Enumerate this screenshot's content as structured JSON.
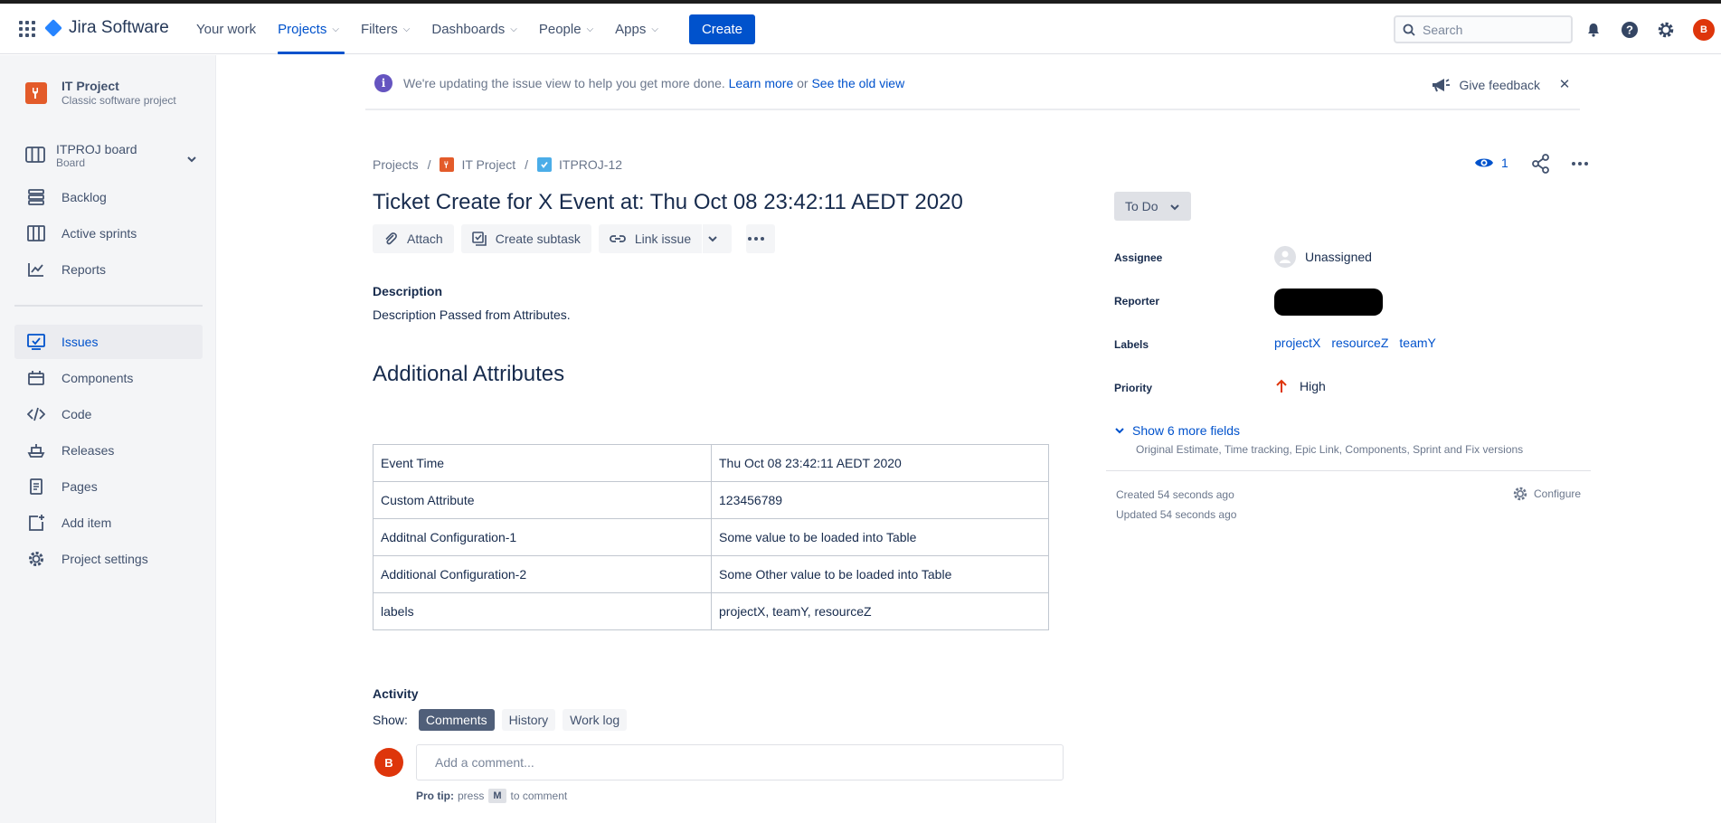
{
  "header": {
    "product": "Jira Software",
    "nav": [
      {
        "label": "Your work",
        "dropdown": false,
        "active": false
      },
      {
        "label": "Projects",
        "dropdown": true,
        "active": true
      },
      {
        "label": "Filters",
        "dropdown": true,
        "active": false
      },
      {
        "label": "Dashboards",
        "dropdown": true,
        "active": false
      },
      {
        "label": "People",
        "dropdown": true,
        "active": false
      },
      {
        "label": "Apps",
        "dropdown": true,
        "active": false
      }
    ],
    "create_label": "Create",
    "search_placeholder": "Search",
    "avatar_initial": "B"
  },
  "sidebar": {
    "project_name": "IT Project",
    "project_type": "Classic software project",
    "board_name": "ITPROJ board",
    "board_type": "Board",
    "items": [
      {
        "label": "Backlog",
        "icon": "backlog-icon"
      },
      {
        "label": "Active sprints",
        "icon": "active-sprints-icon"
      },
      {
        "label": "Reports",
        "icon": "reports-icon"
      }
    ],
    "items2": [
      {
        "label": "Issues",
        "icon": "issues-icon",
        "active": true
      },
      {
        "label": "Components",
        "icon": "components-icon"
      },
      {
        "label": "Code",
        "icon": "code-icon"
      },
      {
        "label": "Releases",
        "icon": "releases-icon"
      },
      {
        "label": "Pages",
        "icon": "pages-icon"
      },
      {
        "label": "Add item",
        "icon": "add-item-icon"
      },
      {
        "label": "Project settings",
        "icon": "settings-icon"
      }
    ]
  },
  "banner": {
    "text": "We're updating the issue view to help you get more done.",
    "learn_more": "Learn more",
    "or": "or",
    "old_view": "See the old view",
    "feedback": "Give feedback"
  },
  "issue": {
    "breadcrumb": [
      "Projects",
      "IT Project",
      "ITPROJ-12"
    ],
    "title": "Ticket Create for X Event at: Thu Oct 08 23:42:11 AEDT 2020",
    "toolbar": {
      "attach": "Attach",
      "subtask": "Create subtask",
      "link": "Link issue"
    },
    "description_heading": "Description",
    "description": "Description Passed from Attributes.",
    "additional_heading": "Additional Attributes",
    "attributes": [
      [
        "Event Time",
        "Thu Oct 08 23:42:11 AEDT 2020"
      ],
      [
        "Custom Attribute",
        "123456789"
      ],
      [
        "Additnal Configuration-1",
        "Some value to be loaded into Table"
      ],
      [
        "Additional Configuration-2",
        "Some Other value to be loaded into Table"
      ],
      [
        "labels",
        "projectX, teamY, resourceZ"
      ]
    ],
    "activity": {
      "heading": "Activity",
      "show_label": "Show:",
      "tabs": [
        "Comments",
        "History",
        "Work log"
      ],
      "comment_placeholder": "Add a comment...",
      "protip_bold": "Pro tip:",
      "protip_press": "press",
      "protip_key": "M",
      "protip_rest": "to comment"
    }
  },
  "details": {
    "watch_count": "1",
    "status": "To Do",
    "assignee_label": "Assignee",
    "assignee": "Unassigned",
    "reporter_label": "Reporter",
    "labels_label": "Labels",
    "labels": [
      "projectX",
      "resourceZ",
      "teamY"
    ],
    "priority_label": "Priority",
    "priority": "High",
    "more_fields": "Show 6 more fields",
    "more_fields_sub": "Original Estimate, Time tracking, Epic Link, Components, Sprint and Fix versions",
    "created": "Created 54 seconds ago",
    "updated": "Updated 54 seconds ago",
    "configure": "Configure",
    "colors": {
      "brand": "#0052cc",
      "priority_high": "#de350b",
      "project_icon": "#e35b2a"
    }
  }
}
